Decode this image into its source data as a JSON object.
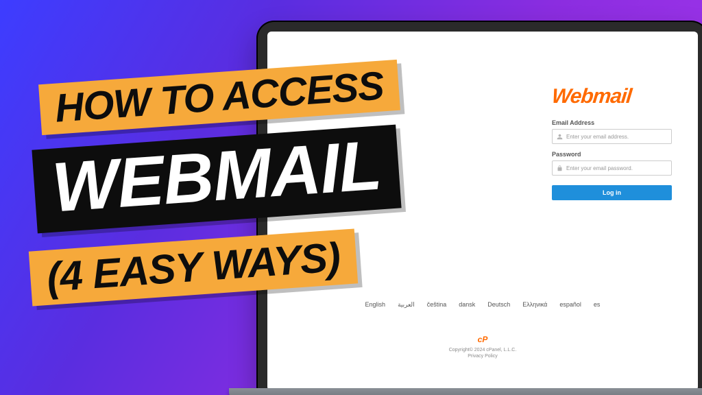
{
  "overlay": {
    "line1": "HOW TO ACCESS",
    "line2": "WEBMAIL",
    "line3": "(4 EASY WAYS)"
  },
  "login": {
    "logo_text": "Webmail",
    "email_label": "Email Address",
    "email_placeholder": "Enter your email address.",
    "password_label": "Password",
    "password_placeholder": "Enter your email password.",
    "login_button": "Log in"
  },
  "languages": [
    "English",
    "العربية",
    "čeština",
    "dansk",
    "Deutsch",
    "Ελληνικά",
    "español",
    "es"
  ],
  "footer": {
    "cp_mark": "cP",
    "copyright": "Copyright© 2024 cPanel, L.L.C.",
    "privacy": "Privacy Policy"
  }
}
